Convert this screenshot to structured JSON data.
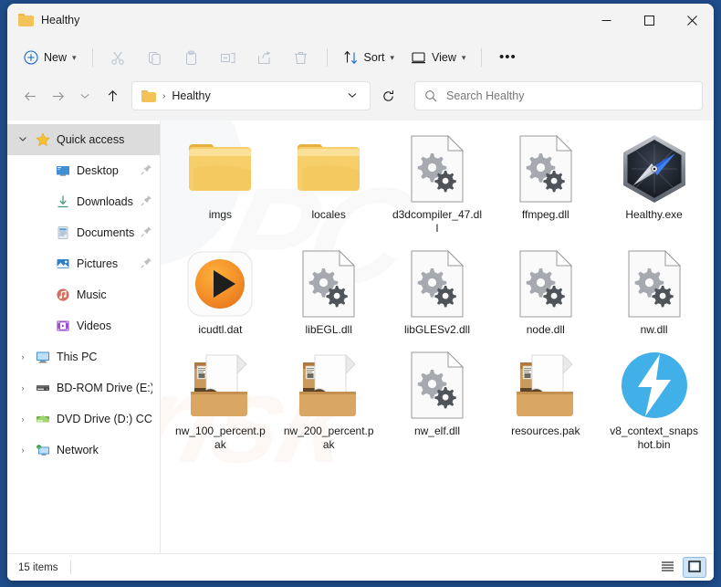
{
  "window": {
    "title": "Healthy",
    "title_icon": "folder-icon",
    "controls": {
      "minimize": "—",
      "maximize": "maximize-icon",
      "close": "✕"
    }
  },
  "toolbar": {
    "new_label": "New",
    "new_icon": "plus-circle-icon",
    "cut_icon": "scissors-icon",
    "copy_icon": "copy-icon",
    "paste_icon": "paste-icon",
    "rename_icon": "rename-icon",
    "share_icon": "share-icon",
    "delete_icon": "trash-icon",
    "sort_label": "Sort",
    "sort_icon": "sort-arrows-icon",
    "view_label": "View",
    "view_icon": "monitor-icon",
    "more_label": "•••"
  },
  "addressbar": {
    "back_icon": "arrow-left-icon",
    "forward_icon": "arrow-right-icon",
    "recent_icon": "chevron-down-icon",
    "up_icon": "arrow-up-icon",
    "crumb_separator": "›",
    "crumb_text": "Healthy",
    "refresh_icon": "refresh-icon",
    "search_icon": "search-icon",
    "search_placeholder": "Search Healthy",
    "search_value": ""
  },
  "sidebar": {
    "items": [
      {
        "label": "Quick access",
        "icon": "star-icon",
        "twisty": "⌄",
        "selected": true,
        "indent": false,
        "pinned": false
      },
      {
        "label": "Desktop",
        "icon": "desktop-icon",
        "twisty": "",
        "selected": false,
        "indent": true,
        "pinned": true
      },
      {
        "label": "Downloads",
        "icon": "downloads-icon",
        "twisty": "",
        "selected": false,
        "indent": true,
        "pinned": true
      },
      {
        "label": "Documents",
        "icon": "documents-icon",
        "twisty": "",
        "selected": false,
        "indent": true,
        "pinned": true
      },
      {
        "label": "Pictures",
        "icon": "pictures-icon",
        "twisty": "",
        "selected": false,
        "indent": true,
        "pinned": true
      },
      {
        "label": "Music",
        "icon": "music-icon",
        "twisty": "",
        "selected": false,
        "indent": true,
        "pinned": false
      },
      {
        "label": "Videos",
        "icon": "videos-icon",
        "twisty": "",
        "selected": false,
        "indent": true,
        "pinned": false
      },
      {
        "label": "This PC",
        "icon": "this-pc-icon",
        "twisty": "›",
        "selected": false,
        "indent": false,
        "pinned": false
      },
      {
        "label": "BD-ROM Drive (E:) C",
        "icon": "bd-rom-drive-icon",
        "twisty": "›",
        "selected": false,
        "indent": false,
        "pinned": false
      },
      {
        "label": "DVD Drive (D:) CCCC",
        "icon": "dvd-drive-icon",
        "twisty": "›",
        "selected": false,
        "indent": false,
        "pinned": false
      },
      {
        "label": "Network",
        "icon": "network-icon",
        "twisty": "›",
        "selected": false,
        "indent": false,
        "pinned": false
      }
    ]
  },
  "files": [
    {
      "name": "imgs",
      "icon": "folder-icon"
    },
    {
      "name": "locales",
      "icon": "folder-icon"
    },
    {
      "name": "d3dcompiler_47.dll",
      "icon": "dll-gears-icon"
    },
    {
      "name": "ffmpeg.dll",
      "icon": "dll-gears-icon"
    },
    {
      "name": "Healthy.exe",
      "icon": "healthy-compass-icon"
    },
    {
      "name": "icudtl.dat",
      "icon": "orange-play-icon"
    },
    {
      "name": "libEGL.dll",
      "icon": "dll-gears-icon"
    },
    {
      "name": "libGLESv2.dll",
      "icon": "dll-gears-icon"
    },
    {
      "name": "node.dll",
      "icon": "dll-gears-icon"
    },
    {
      "name": "nw.dll",
      "icon": "dll-gears-icon"
    },
    {
      "name": "nw_100_percent.pak",
      "icon": "package-box-icon"
    },
    {
      "name": "nw_200_percent.pak",
      "icon": "package-box-icon"
    },
    {
      "name": "nw_elf.dll",
      "icon": "dll-gears-icon"
    },
    {
      "name": "resources.pak",
      "icon": "package-box-icon"
    },
    {
      "name": "v8_context_snapshot.bin",
      "icon": "blue-bolt-icon"
    }
  ],
  "statusbar": {
    "item_count": "15 items",
    "details_view_icon": "details-view-icon",
    "large-icons_view_icon": "large-icons-view-icon"
  },
  "watermark": {
    "text": "PC",
    "text2": "risk"
  },
  "colors": {
    "desktop_blue": "#1f4e8c",
    "chrome_gray": "#f3f3f3",
    "accent_blue": "#0067c0",
    "folder_yellow": "#f3c35a",
    "selection_gray": "#dcdcdc"
  }
}
